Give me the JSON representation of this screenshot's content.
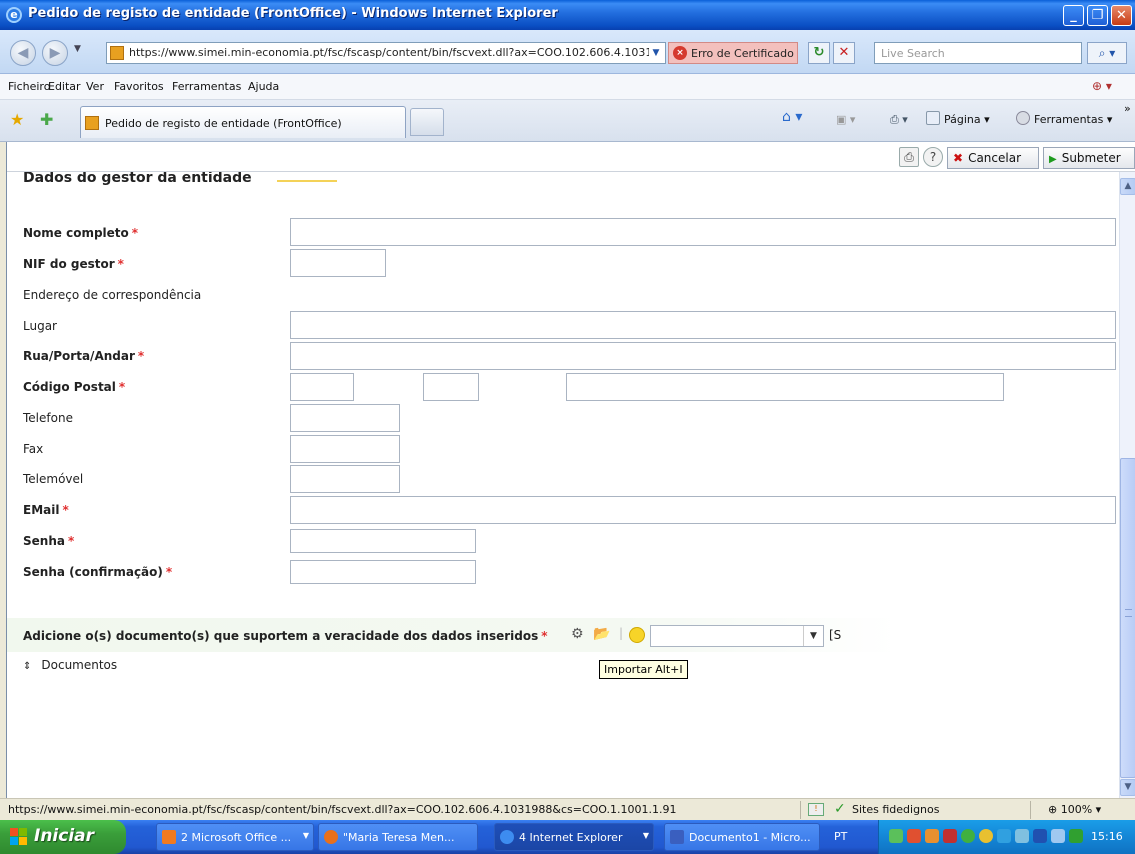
{
  "window": {
    "title": "Pedido de registo de entidade (FrontOffice) - Windows Internet Explorer"
  },
  "address_bar": {
    "url": "https://www.simei.min-economia.pt/fsc/fscasp/content/bin/fscvext.dll?ax=COO.102.606.4.10319",
    "cert_error": "Erro de Certificado",
    "search_placeholder": "Live Search"
  },
  "menu": {
    "items": [
      "Ficheiro",
      "Editar",
      "Ver",
      "Favoritos",
      "Ferramentas",
      "Ajuda"
    ]
  },
  "tabs": {
    "active_tab": "Pedido de registo de entidade (FrontOffice)",
    "page_label": "Página",
    "tools_label": "Ferramentas"
  },
  "app_toolbar": {
    "cancel_label": "Cancelar",
    "submit_label": "Submeter"
  },
  "form": {
    "section_title": "Dados do gestor da entidade",
    "fields": [
      {
        "label": "Nome completo",
        "required": "*",
        "value": ""
      },
      {
        "label": "NIF do gestor",
        "required": "*",
        "value": ""
      },
      {
        "label": "Endereço de correspondência",
        "required": ""
      },
      {
        "label": "Lugar",
        "required": "",
        "value": ""
      },
      {
        "label": "Rua/Porta/Andar",
        "required": "*",
        "value": ""
      },
      {
        "label": "Código Postal",
        "required": "*",
        "value": ""
      },
      {
        "label": "Telefone",
        "required": "",
        "value": ""
      },
      {
        "label": "Fax",
        "required": "",
        "value": ""
      },
      {
        "label": "Telemóvel",
        "required": "",
        "value": ""
      },
      {
        "label": "EMail",
        "required": "*",
        "value": ""
      },
      {
        "label": "Senha",
        "required": "*",
        "value": ""
      },
      {
        "label": "Senha (confirmação)",
        "required": "*",
        "value": ""
      }
    ],
    "documents_prompt": "Adicione o(s) documento(s) que suportem a veracidade dos dados inseridos",
    "documents_required": "*",
    "documents_select_value": "",
    "bracket_text": "[S",
    "tooltip": "Importar Alt+I",
    "documents_label": "Documentos"
  },
  "status_bar": {
    "url": "https://www.simei.min-economia.pt/fsc/fscasp/content/bin/fscvext.dll?ax=COO.102.606.4.1031988&cs=COO.1.1001.1.91",
    "zone": "Sites fidedignos",
    "zoom": "100%"
  },
  "taskbar": {
    "start_label": "Iniciar",
    "tasks": [
      {
        "label": "2 Microsoft Office ..."
      },
      {
        "label": "\"Maria Teresa Men..."
      },
      {
        "label": "4 Internet Explorer"
      },
      {
        "label": "Documento1 - Micro..."
      }
    ],
    "language": "PT",
    "clock": "15:16"
  }
}
